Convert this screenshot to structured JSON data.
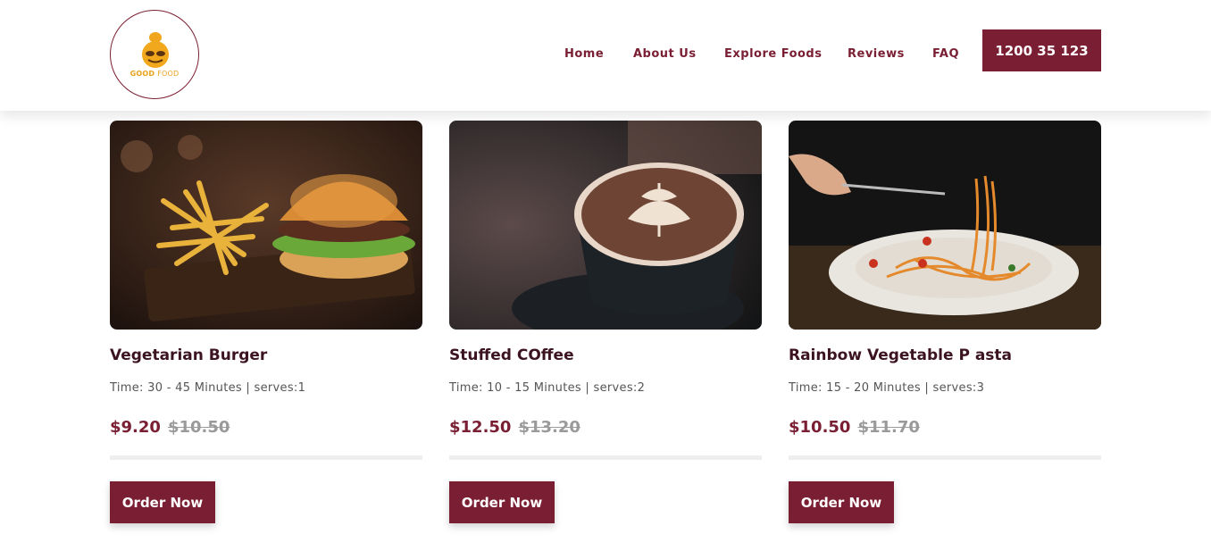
{
  "brand": {
    "logo_text_bold": "GOOD",
    "logo_text_light": "FOOD",
    "accent_color": "#7a1f33",
    "logo_color": "#e8a21b"
  },
  "nav": {
    "items": [
      {
        "label": "Home"
      },
      {
        "label": "About Us"
      },
      {
        "label": "Explore Foods"
      },
      {
        "label": "Reviews"
      },
      {
        "label": "FAQ"
      }
    ],
    "phone_label": "1200 35 123"
  },
  "products": [
    {
      "title": "Vegetarian Burger",
      "meta": "Time: 30 - 45 Minutes | serves:1",
      "price": "$9.20",
      "old_price": "$10.50",
      "button_label": "Order Now",
      "image_icon": "burger-photo"
    },
    {
      "title": "Stuffed COffee",
      "meta": "Time: 10 - 15 Minutes | serves:2",
      "price": "$12.50",
      "old_price": "$13.20",
      "button_label": "Order Now",
      "image_icon": "coffee-photo"
    },
    {
      "title": "Rainbow Vegetable P asta",
      "meta": "Time: 15 - 20 Minutes | serves:3",
      "price": "$10.50",
      "old_price": "$11.70",
      "button_label": "Order Now",
      "image_icon": "pasta-photo"
    }
  ]
}
